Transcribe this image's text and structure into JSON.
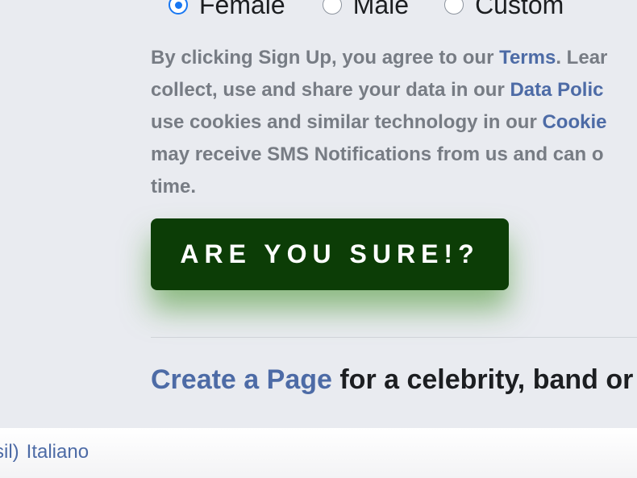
{
  "gender": {
    "options": [
      {
        "label": "Female",
        "checked": true
      },
      {
        "label": "Male",
        "checked": false
      },
      {
        "label": "Custom",
        "checked": false
      }
    ]
  },
  "terms": {
    "line1_text": "By clicking Sign Up, you agree to our ",
    "line1_link": "Terms",
    "line1_tail": ". Lear",
    "line2_text": "collect, use and share your data in our ",
    "line2_link": "Data Polic",
    "line3_text": "use cookies and similar technology in our ",
    "line3_link": "Cookie",
    "line4_text": "may receive SMS Notifications from us and can o",
    "line5_text": "time."
  },
  "button": {
    "label": "ARE YOU SURE!?"
  },
  "create_page": {
    "link": "Create a Page",
    "text": " for a celebrity, band or"
  },
  "footer": {
    "languages": [
      "sil)",
      "Italiano"
    ]
  },
  "colors": {
    "background": "#e9ebf0",
    "link": "#4d6ba6",
    "button_bg": "#0c3d06",
    "button_glow": "#5aa046",
    "radio_accent": "#1877f2"
  }
}
